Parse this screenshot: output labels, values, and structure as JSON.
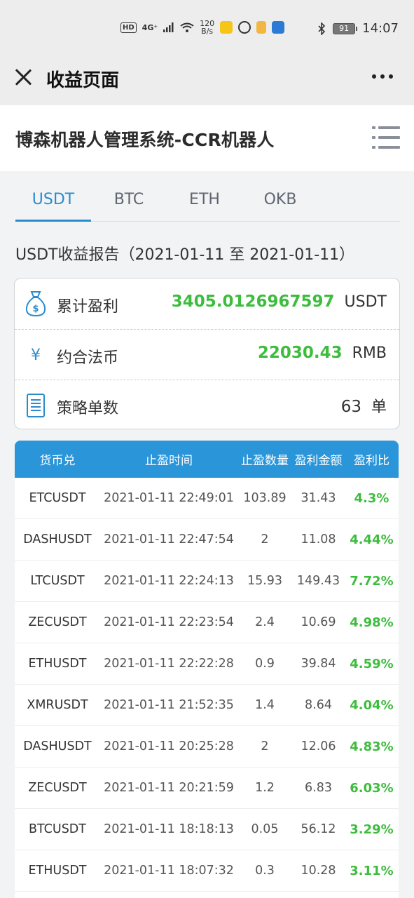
{
  "status": {
    "hd": "HD",
    "network": "4G⁺",
    "speed_value": "120",
    "speed_unit": "B/s",
    "battery": "91",
    "time": "14:07"
  },
  "titlebar": {
    "title": "收益页面"
  },
  "app": {
    "title": "博森机器人管理系统-CCR机器人"
  },
  "tabs": [
    {
      "label": "USDT",
      "active": true
    },
    {
      "label": "BTC",
      "active": false
    },
    {
      "label": "ETH",
      "active": false
    },
    {
      "label": "OKB",
      "active": false
    }
  ],
  "report": {
    "title": "USDT收益报告（2021-01-11 至 2021-01-11）"
  },
  "summary": {
    "profit_label": "累计盈利",
    "profit_value": "3405.0126967597",
    "profit_unit": "USDT",
    "fiat_symbol": "¥",
    "fiat_label": "约合法币",
    "fiat_value": "22030.43",
    "fiat_unit": "RMB",
    "orders_label": "策略单数",
    "orders_value": "63",
    "orders_unit": "单"
  },
  "table": {
    "headers": [
      "货币兑",
      "止盈时间",
      "止盈数量",
      "盈利金额",
      "盈利比"
    ],
    "rows": [
      [
        "ETCUSDT",
        "2021-01-11 22:49:01",
        "103.89",
        "31.43",
        "4.3%"
      ],
      [
        "DASHUSDT",
        "2021-01-11 22:47:54",
        "2",
        "11.08",
        "4.44%"
      ],
      [
        "LTCUSDT",
        "2021-01-11 22:24:13",
        "15.93",
        "149.43",
        "7.72%"
      ],
      [
        "ZECUSDT",
        "2021-01-11 22:23:54",
        "2.4",
        "10.69",
        "4.98%"
      ],
      [
        "ETHUSDT",
        "2021-01-11 22:22:28",
        "0.9",
        "39.84",
        "4.59%"
      ],
      [
        "XMRUSDT",
        "2021-01-11 21:52:35",
        "1.4",
        "8.64",
        "4.04%"
      ],
      [
        "DASHUSDT",
        "2021-01-11 20:25:28",
        "2",
        "12.06",
        "4.83%"
      ],
      [
        "ZECUSDT",
        "2021-01-11 20:21:59",
        "1.2",
        "6.83",
        "6.03%"
      ],
      [
        "BTCUSDT",
        "2021-01-11 18:18:13",
        "0.05",
        "56.12",
        "3.29%"
      ],
      [
        "ETHUSDT",
        "2021-01-11 18:07:32",
        "0.3",
        "10.28",
        "3.11%"
      ]
    ]
  },
  "colors": {
    "accent": "#2a8ccc",
    "header_bg": "#2a95d8",
    "profit_green": "#3dbd3d"
  },
  "icons": {
    "close": "close-icon",
    "more": "more-icon",
    "menu": "menu-icon",
    "money_bag": "money-bag-icon",
    "yuan": "yuan-icon",
    "document": "document-icon"
  }
}
